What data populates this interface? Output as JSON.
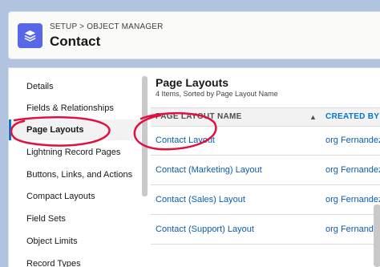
{
  "header": {
    "breadcrumb": {
      "setup": "SETUP",
      "separator": ">",
      "object_manager": "OBJECT MANAGER"
    },
    "title": "Contact",
    "icon": "layers-icon",
    "icon_color": "#5867e8"
  },
  "sidebar": {
    "items": [
      {
        "label": "Details",
        "active": false
      },
      {
        "label": "Fields & Relationships",
        "active": false
      },
      {
        "label": "Page Layouts",
        "active": true
      },
      {
        "label": "Lightning Record Pages",
        "active": false
      },
      {
        "label": "Buttons, Links, and Actions",
        "active": false
      },
      {
        "label": "Compact Layouts",
        "active": false
      },
      {
        "label": "Field Sets",
        "active": false
      },
      {
        "label": "Object Limits",
        "active": false
      },
      {
        "label": "Record Types",
        "active": false
      }
    ]
  },
  "main": {
    "title": "Page Layouts",
    "subtitle": "4 Items, Sorted by Page Layout Name",
    "columns": [
      "PAGE LAYOUT NAME",
      "CREATED BY"
    ],
    "sort_icon": "sort-up-arrow-icon",
    "rows": [
      {
        "name": "Contact Layout",
        "created_by": "org Fernandez,"
      },
      {
        "name": "Contact (Marketing) Layout",
        "created_by": "org Fernandez,"
      },
      {
        "name": "Contact (Sales) Layout",
        "created_by": "org Fernandez,"
      },
      {
        "name": "Contact (Support) Layout",
        "created_by": "org Fernandez,"
      }
    ]
  },
  "colors": {
    "background": "#b0c4df",
    "link": "#0b5cab",
    "accent": "#0176d3",
    "annotation": "#e01040"
  }
}
